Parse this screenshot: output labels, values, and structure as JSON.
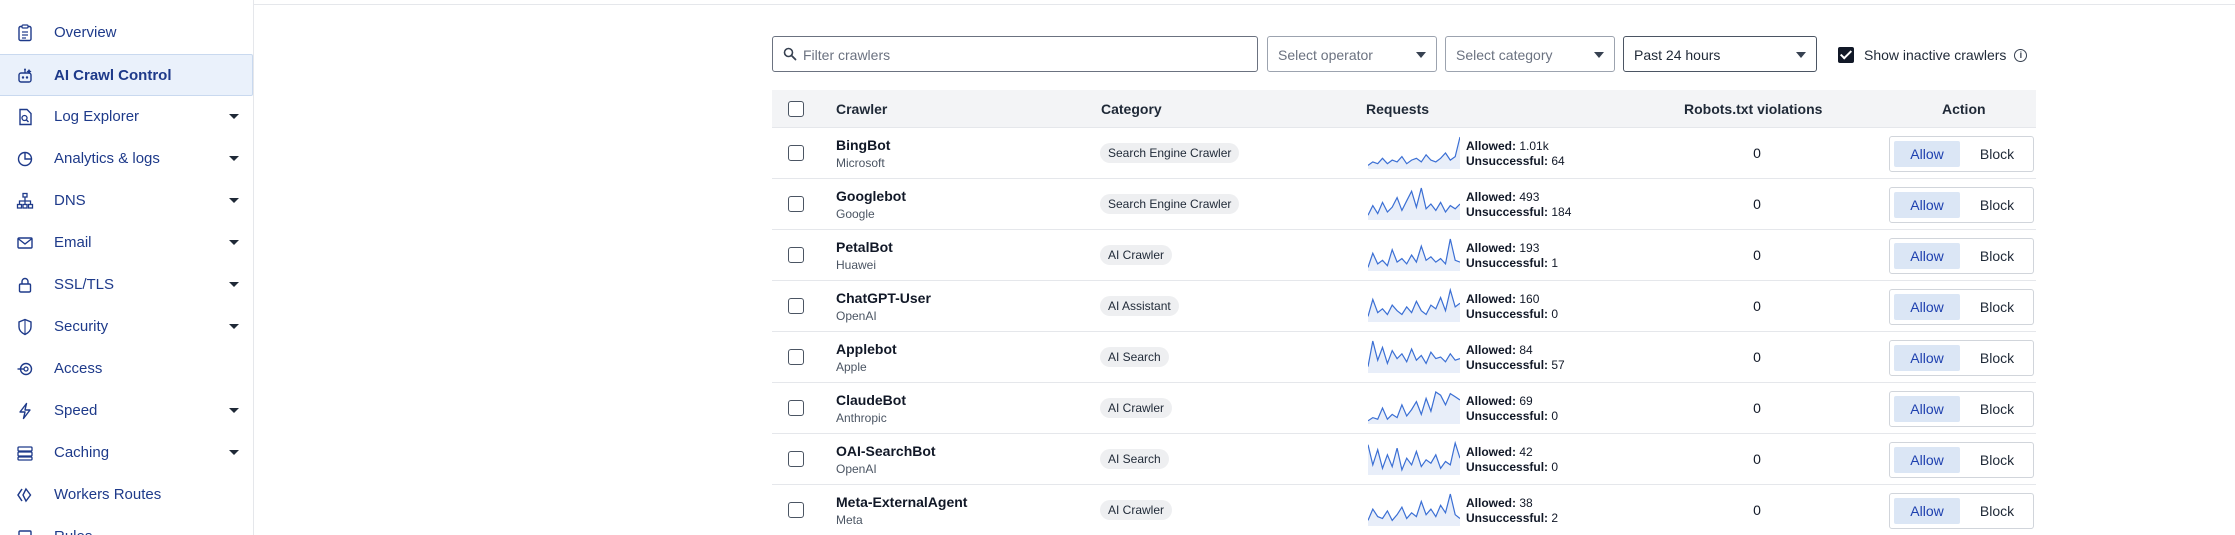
{
  "sidebar": {
    "items": [
      {
        "label": "Overview",
        "icon": "clipboard-icon",
        "caret": false
      },
      {
        "label": "AI Crawl Control",
        "icon": "robot-icon",
        "caret": false
      },
      {
        "label": "Log Explorer",
        "icon": "file-search-icon",
        "caret": true
      },
      {
        "label": "Analytics & logs",
        "icon": "pie-chart-icon",
        "caret": true
      },
      {
        "label": "DNS",
        "icon": "network-icon",
        "caret": true
      },
      {
        "label": "Email",
        "icon": "envelope-icon",
        "caret": true
      },
      {
        "label": "SSL/TLS",
        "icon": "lock-icon",
        "caret": true
      },
      {
        "label": "Security",
        "icon": "shield-icon",
        "caret": true
      },
      {
        "label": "Access",
        "icon": "access-icon",
        "caret": false
      },
      {
        "label": "Speed",
        "icon": "lightning-icon",
        "caret": true
      },
      {
        "label": "Caching",
        "icon": "server-stack-icon",
        "caret": true
      },
      {
        "label": "Workers Routes",
        "icon": "workers-icon",
        "caret": false
      },
      {
        "label": "Rules",
        "icon": "rules-icon",
        "caret": false
      }
    ]
  },
  "filters": {
    "search_placeholder": "Filter crawlers",
    "operator_placeholder": "Select operator",
    "category_placeholder": "Select category",
    "time_range": "Past 24 hours",
    "show_inactive_label": "Show inactive crawlers",
    "show_inactive_checked": true
  },
  "table": {
    "headers": {
      "crawler": "Crawler",
      "category": "Category",
      "requests": "Requests",
      "violations": "Robots.txt violations",
      "action": "Action"
    },
    "allowed_label": "Allowed:",
    "unsuccessful_label": "Unsuccessful:",
    "allow_label": "Allow",
    "block_label": "Block",
    "rows": [
      {
        "name": "BingBot",
        "org": "Microsoft",
        "category": "Search Engine Crawler",
        "allowed": "1.01k",
        "unsuccessful": "64",
        "violations": "0",
        "spark": [
          2,
          4,
          3,
          6,
          3,
          5,
          4,
          7,
          3,
          5,
          6,
          4,
          8,
          5,
          4,
          6,
          9,
          5,
          7,
          18
        ]
      },
      {
        "name": "Googlebot",
        "org": "Google",
        "category": "Search Engine Crawler",
        "allowed": "493",
        "unsuccessful": "184",
        "violations": "0",
        "spark": [
          3,
          9,
          4,
          11,
          5,
          8,
          14,
          6,
          12,
          18,
          8,
          20,
          7,
          10,
          6,
          11,
          5,
          9,
          7,
          10
        ]
      },
      {
        "name": "PetalBot",
        "org": "Huawei",
        "category": "AI Crawler",
        "allowed": "193",
        "unsuccessful": "1",
        "violations": "0",
        "spark": [
          2,
          10,
          4,
          6,
          3,
          12,
          5,
          7,
          4,
          9,
          5,
          14,
          6,
          8,
          5,
          7,
          4,
          18,
          6,
          5
        ]
      },
      {
        "name": "ChatGPT-User",
        "org": "OpenAI",
        "category": "AI Assistant",
        "allowed": "160",
        "unsuccessful": "0",
        "violations": "0",
        "spark": [
          3,
          12,
          5,
          7,
          4,
          9,
          6,
          4,
          8,
          5,
          11,
          6,
          4,
          9,
          7,
          13,
          6,
          17,
          8,
          10
        ]
      },
      {
        "name": "Applebot",
        "org": "Apple",
        "category": "AI Search",
        "allowed": "84",
        "unsuccessful": "57",
        "violations": "0",
        "spark": [
          4,
          20,
          8,
          16,
          6,
          14,
          9,
          12,
          7,
          15,
          8,
          11,
          6,
          13,
          9,
          10,
          7,
          12,
          8,
          9
        ]
      },
      {
        "name": "ClaudeBot",
        "org": "Anthropic",
        "category": "AI Crawler",
        "allowed": "69",
        "unsuccessful": "0",
        "violations": "0",
        "spark": [
          2,
          4,
          3,
          10,
          3,
          6,
          4,
          12,
          5,
          9,
          14,
          6,
          16,
          8,
          20,
          18,
          12,
          19,
          17,
          15
        ]
      },
      {
        "name": "OAI-SearchBot",
        "org": "OpenAI",
        "category": "AI Search",
        "allowed": "42",
        "unsuccessful": "0",
        "violations": "0",
        "spark": [
          18,
          6,
          15,
          4,
          12,
          5,
          16,
          3,
          10,
          6,
          14,
          5,
          9,
          7,
          12,
          4,
          8,
          6,
          19,
          10
        ]
      },
      {
        "name": "Meta-ExternalAgent",
        "org": "Meta",
        "category": "AI Crawler",
        "allowed": "38",
        "unsuccessful": "2",
        "violations": "0",
        "spark": [
          3,
          9,
          5,
          4,
          8,
          3,
          6,
          10,
          4,
          7,
          5,
          13,
          6,
          9,
          5,
          11,
          7,
          17,
          6,
          4
        ]
      }
    ]
  }
}
